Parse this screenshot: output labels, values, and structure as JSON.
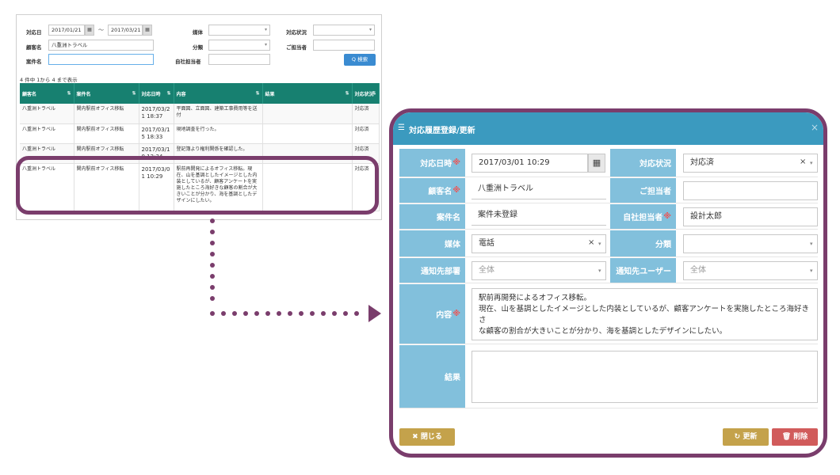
{
  "search": {
    "date_label": "対応日",
    "date_from": "2017/01/21",
    "date_to": "2017/03/21",
    "date_sep": "〜",
    "medium_label": "媒体",
    "status_label": "対応状況",
    "client_label": "顧客名",
    "client_value": "八重洲トラベル",
    "category_label": "分類",
    "contact_label": "ご担当者",
    "case_label": "案件名",
    "staff_label": "自社担当者",
    "search_button": "Q 検索",
    "calendar_icon": "▦"
  },
  "list": {
    "count_text": "4 件中 1から 4 まで表示",
    "columns": [
      "顧客名",
      "案件名",
      "対応日時",
      "内容",
      "結果",
      "対応状況"
    ],
    "sort_icon": "⇅",
    "rows": [
      [
        "八重洲トラベル",
        "関内駅前オフィス移転",
        "2017/03/2 1 18:37",
        "平面図、立面図、建築工事費用等を送付",
        "",
        "対応済"
      ],
      [
        "八重洲トラベル",
        "関内駅前オフィス移転",
        "2017/03/1 5 18:33",
        "現地調査を行った。",
        "",
        "対応済"
      ],
      [
        "八重洲トラベル",
        "関内駅前オフィス移転",
        "2017/03/1 0 13:34",
        "登記簿より権利関係を確認した。",
        "",
        "対応済"
      ],
      [
        "八重洲トラベル",
        "関内駅前オフィス移転",
        "2017/03/0 1 10:29",
        "駅前再開発によるオフィス移転。現在、山を基調としたイメージとした内装としているが、顧客アンケートを実施したところ海好きな顧客の割合が大きいことが分かり、海を基調としたデザインにしたい。",
        "",
        "対応済"
      ]
    ]
  },
  "modal": {
    "title": "対応履歴登録/更新",
    "title_icon": "☰",
    "close_icon": "×",
    "labels": {
      "datetime": "対応日時",
      "status": "対応状況",
      "client": "顧客名",
      "contact": "ご担当者",
      "case": "案件名",
      "staff": "自社担当者",
      "medium": "媒体",
      "category": "分類",
      "notify_dept": "通知先部署",
      "notify_user": "通知先ユーザー",
      "content": "内容",
      "result": "結果"
    },
    "required_mark": "※",
    "values": {
      "datetime": "2017/03/01 10:29",
      "status": "対応済",
      "client": "八重洲トラベル",
      "contact": "",
      "case": "案件未登録",
      "staff": "設計太郎",
      "medium": "電話",
      "category": "",
      "notify_dept": "全体",
      "notify_user": "全体",
      "content_lines": [
        "駅前再開発によるオフィス移転。",
        "現在、山を基調としたイメージとした内装としているが、顧客アンケートを実施したところ海好きさ",
        "な顧客の割合が大きいことが分かり、海を基調としたデザインにしたい。"
      ],
      "result": ""
    },
    "clear_icon": "×",
    "caret_icon": "▾",
    "calendar_icon": "▦",
    "buttons": {
      "close": "✖ 閉じる",
      "update": "↻ 更新",
      "delete": "🗑 削除"
    }
  }
}
